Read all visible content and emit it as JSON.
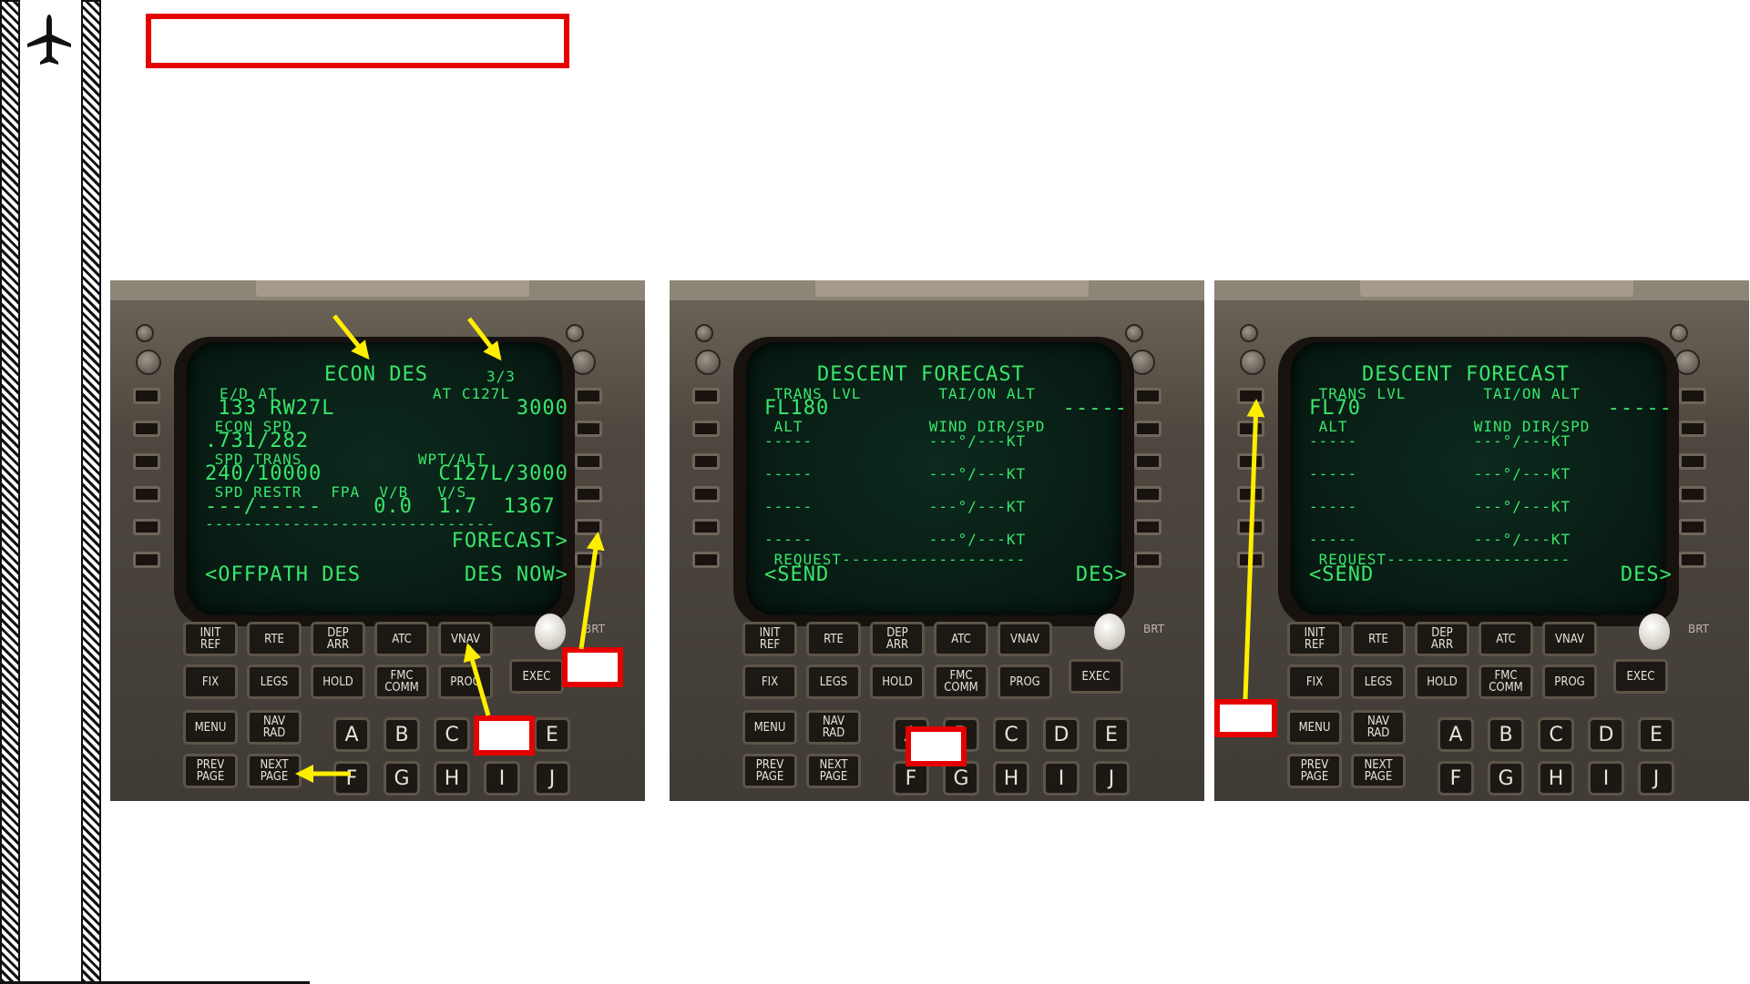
{
  "colors": {
    "accent_red": "#e60000",
    "arrow_yellow": "#ffee00",
    "crt_green": "#39e66a"
  },
  "icons": {
    "logo": "airplane-icon"
  },
  "cdu_keys": {
    "init_ref": "INIT\nREF",
    "rte": "RTE",
    "dep_arr": "DEP\nARR",
    "atc": "ATC",
    "vnav": "VNAV",
    "fix": "FIX",
    "legs": "LEGS",
    "hold": "HOLD",
    "fmc_comm": "FMC\nCOMM",
    "prog": "PROG",
    "exec": "EXEC",
    "menu": "MENU",
    "nav_rad": "NAV\nRAD",
    "prev_page": "PREV\nPAGE",
    "next_page": "NEXT\nPAGE",
    "brt": "BRT",
    "alpha_row1": [
      "A",
      "B",
      "C",
      "D",
      "E"
    ],
    "alpha_row2": [
      "F",
      "G",
      "H",
      "I",
      "J"
    ]
  },
  "screens": [
    {
      "title": "ECON DES",
      "page": "3/3",
      "lines": [
        "E/D AT                AT C127L",
        " 133 RW27L              3000",
        " ECON SPD",
        ".731/282",
        " SPD TRANS            WPT/ALT",
        "240/10000         C127L/3000",
        " SPD RESTR   FPA  V/B   V/S",
        "---/-----    0.0  1.7  1367",
        "------------------------------",
        "                   FORECAST>",
        "<OFFPATH DES        DES NOW>"
      ]
    },
    {
      "title": "DESCENT FORECAST",
      "lines": [
        " TRANS LVL        TAI/ON ALT",
        "FL180                  -----",
        " ALT             WIND DIR/SPD",
        "-----            ---°/---KT",
        "",
        "-----            ---°/---KT",
        "",
        "-----            ---°/---KT",
        "",
        "-----            ---°/---KT",
        " REQUEST-------------------",
        "<SEND                   DES>"
      ]
    },
    {
      "title": "DESCENT FORECAST",
      "lines": [
        " TRANS LVL        TAI/ON ALT",
        "FL70                   -----",
        " ALT             WIND DIR/SPD",
        "-----            ---°/---KT",
        "",
        "-----            ---°/---KT",
        "",
        "-----            ---°/---KT",
        "",
        "-----            ---°/---KT",
        " REQUEST-------------------",
        "<SEND                   DES>"
      ]
    }
  ]
}
